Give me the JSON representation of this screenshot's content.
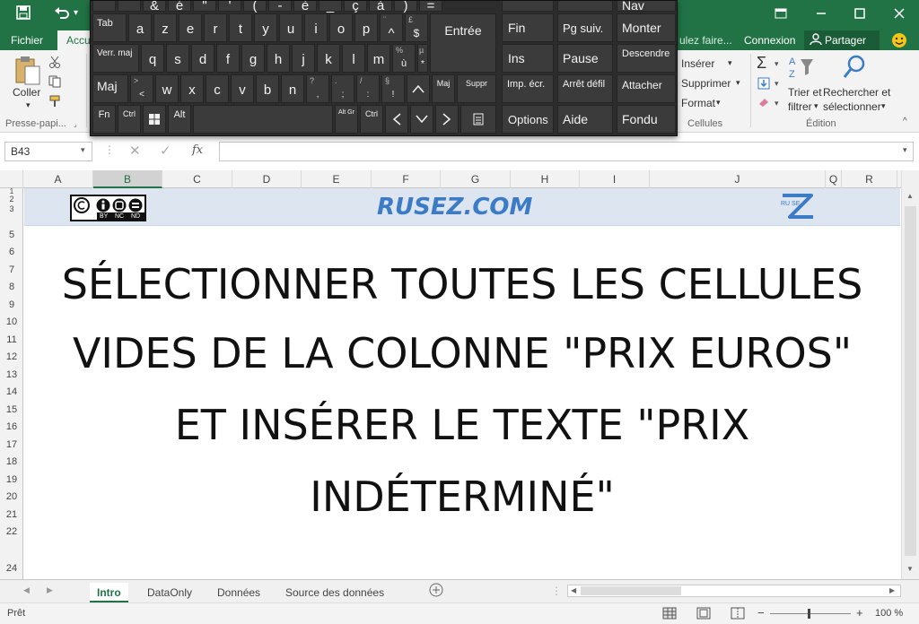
{
  "titlebar": {
    "quick_access": [
      "save-icon",
      "undo-icon"
    ],
    "undo_dropdown": "▾"
  },
  "tabs": {
    "file": "Fichier",
    "home_partial": "Accu",
    "search_partial": "ulez faire...",
    "signin": "Connexion",
    "share": "Partager"
  },
  "ribbon": {
    "clipboard": {
      "paste": "Coller",
      "group_label": "Presse-papi..."
    },
    "cells": {
      "insert": "Insérer",
      "delete": "Supprimer",
      "format": "Format",
      "group_label": "Cellules"
    },
    "editing": {
      "sort_line1": "Trier et",
      "sort_line2": "filtrer",
      "find_line1": "Rechercher et",
      "find_line2": "sélectionner",
      "group_label": "Édition"
    }
  },
  "formula_bar": {
    "name_box": "B43",
    "fx": "fx",
    "formula": ""
  },
  "columns": [
    "A",
    "B",
    "C",
    "D",
    "E",
    "F",
    "G",
    "H",
    "I",
    "J",
    "Q",
    "R"
  ],
  "selected_column": "B",
  "rows": [
    "1",
    "2",
    "3",
    "5",
    "6",
    "7",
    "8",
    "9",
    "10",
    "11",
    "12",
    "13",
    "14",
    "15",
    "16",
    "17",
    "18",
    "19",
    "20",
    "21",
    "22",
    "24"
  ],
  "sheet": {
    "band_title": "RUSEZ.COM",
    "logo_letters": "RU SE",
    "license_labels": [
      "BY",
      "NC",
      "ND"
    ],
    "headline": [
      "SÉLECTIONNER TOUTES LES CELLULES",
      "VIDES DE LA COLONNE \"PRIX EUROS\"",
      "ET INSÉRER LE TEXTE \"PRIX",
      "INDÉTERMINÉ\""
    ]
  },
  "sheet_tabs": [
    "Intro",
    "DataOnly",
    "Données",
    "Source des données"
  ],
  "active_sheet": "Intro",
  "status": {
    "ready": "Prêt",
    "zoom": "100 %"
  },
  "keyboard": {
    "row1": [
      "&",
      "é",
      "\"",
      "'",
      "(",
      "-",
      "è",
      "_",
      "ç",
      "à",
      ")",
      "="
    ],
    "row2": [
      "Tab",
      "a",
      "z",
      "e",
      "r",
      "t",
      "y",
      "u",
      "i",
      "o",
      "p",
      "^",
      "$",
      "Entrée"
    ],
    "row2_sub": [
      "",
      "",
      "",
      "",
      "",
      "",
      "",
      "",
      "",
      "",
      "",
      "¨",
      "£",
      ""
    ],
    "row3": [
      "Verr. maj",
      "q",
      "s",
      "d",
      "f",
      "g",
      "h",
      "j",
      "k",
      "l",
      "m",
      "ù",
      "*"
    ],
    "row3_sub": [
      "",
      "",
      "",
      "",
      "",
      "",
      "",
      "",
      "",
      "",
      "",
      "%",
      "µ"
    ],
    "row4": [
      "Maj",
      "<",
      "w",
      "x",
      "c",
      "v",
      "b",
      "n",
      ",",
      ";",
      ":",
      "!",
      "Maj",
      "Suppr"
    ],
    "row4_sub": [
      "",
      ">",
      "",
      "",
      "",
      "",
      "",
      "",
      "?",
      ".",
      "/",
      "§",
      "",
      ""
    ],
    "row5": [
      "Fn",
      "Ctrl",
      "Alt",
      "Alt Gr",
      "Ctrl"
    ],
    "nav_col1": [
      "Fin",
      "Ins",
      "Imp. écr.",
      "Options"
    ],
    "nav_col2": [
      "Pg suiv.",
      "Pause",
      "Arrêt défil",
      "Aide"
    ],
    "nav_col3": [
      "Nav",
      "Monter",
      "Descendre",
      "Attacher",
      "Fondu"
    ]
  },
  "colors": {
    "excel_green": "#217346",
    "band_blue": "#dde6f0",
    "title_blue": "#3c7bc6",
    "keyboard_bg": "#2d2d2d"
  }
}
